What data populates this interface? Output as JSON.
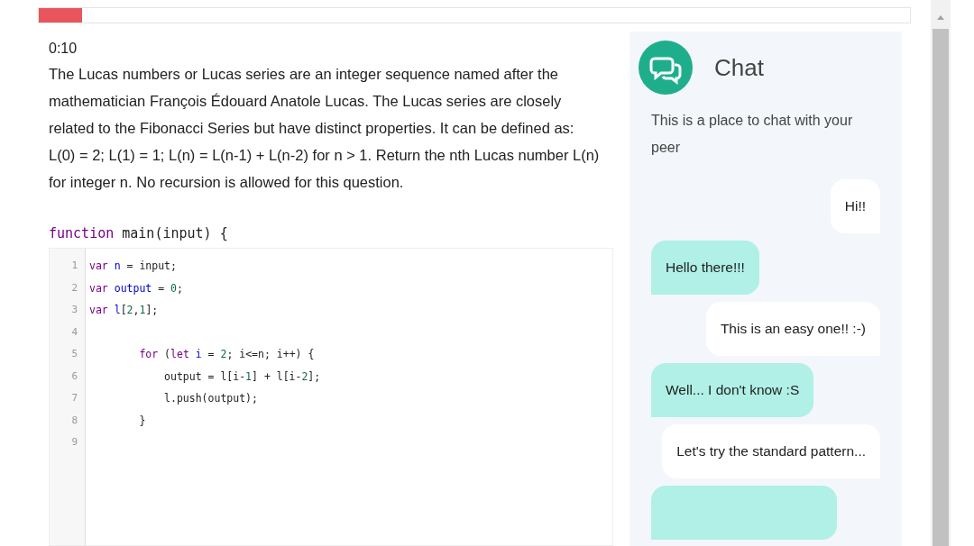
{
  "progress": {
    "level": 0.05
  },
  "timer": "0:10",
  "question": "The Lucas numbers or Lucas series are an integer sequence named after the mathematician François Édouard Anatole Lucas. The Lucas series are closely related to the Fibonacci Series but have distinct properties. It can be defined as: L(0) = 2; L(1) = 1; L(n) = L(n-1) + L(n-2) for n > 1. Return the nth Lucas number L(n) for integer n. No recursion is allowed for this question.",
  "function_header": [
    {
      "kind": "keyword",
      "text": "function"
    },
    {
      "kind": "plain",
      "text": " main(input) {"
    }
  ],
  "code_lines": [
    {
      "number": "1",
      "tokens": [
        {
          "kind": "keyword",
          "text": "var "
        },
        {
          "kind": "def",
          "text": "n"
        },
        {
          "kind": "plain",
          "text": " = input;"
        }
      ]
    },
    {
      "number": "2",
      "tokens": [
        {
          "kind": "keyword",
          "text": "var "
        },
        {
          "kind": "def",
          "text": "output"
        },
        {
          "kind": "plain",
          "text": " = "
        },
        {
          "kind": "number",
          "text": "0"
        },
        {
          "kind": "plain",
          "text": ";"
        }
      ]
    },
    {
      "number": "3",
      "tokens": [
        {
          "kind": "keyword",
          "text": "var "
        },
        {
          "kind": "def",
          "text": "l"
        },
        {
          "kind": "plain",
          "text": "["
        },
        {
          "kind": "number",
          "text": "2"
        },
        {
          "kind": "plain",
          "text": ","
        },
        {
          "kind": "number",
          "text": "1"
        },
        {
          "kind": "plain",
          "text": "];"
        }
      ]
    },
    {
      "number": "4"
    },
    {
      "number": "5",
      "tokens": [
        {
          "kind": "keyword",
          "text": "        for"
        },
        {
          "kind": "plain",
          "text": " ("
        },
        {
          "kind": "keyword",
          "text": "let "
        },
        {
          "kind": "def",
          "text": "i"
        },
        {
          "kind": "plain",
          "text": " = "
        },
        {
          "kind": "number",
          "text": "2"
        },
        {
          "kind": "plain",
          "text": "; i<=n; i++) {"
        }
      ]
    },
    {
      "number": "6",
      "tokens": [
        {
          "kind": "plain",
          "text": "            output = l[i-"
        },
        {
          "kind": "number",
          "text": "1"
        },
        {
          "kind": "plain",
          "text": "] + l[i-"
        },
        {
          "kind": "number",
          "text": "2"
        },
        {
          "kind": "plain",
          "text": "];"
        }
      ]
    },
    {
      "number": "7",
      "tokens": [
        {
          "kind": "plain",
          "text": "            l.push(output);"
        }
      ]
    },
    {
      "number": "8",
      "tokens": [
        {
          "kind": "plain",
          "text": "        }"
        }
      ]
    },
    {
      "number": "9"
    }
  ],
  "chat": {
    "title": "Chat",
    "intro": "This is a place to chat with your peer",
    "messages": [
      {
        "kind": "peer",
        "text": "Hi!!"
      },
      {
        "kind": "self",
        "text": "Hello there!!!"
      },
      {
        "kind": "peer",
        "text": "This is an easy one!! :-)"
      },
      {
        "kind": "self",
        "text": "Well... I don't know :S"
      },
      {
        "kind": "peer",
        "text": "Let's try the standard pattern..."
      },
      {
        "kind": "self"
      }
    ]
  }
}
